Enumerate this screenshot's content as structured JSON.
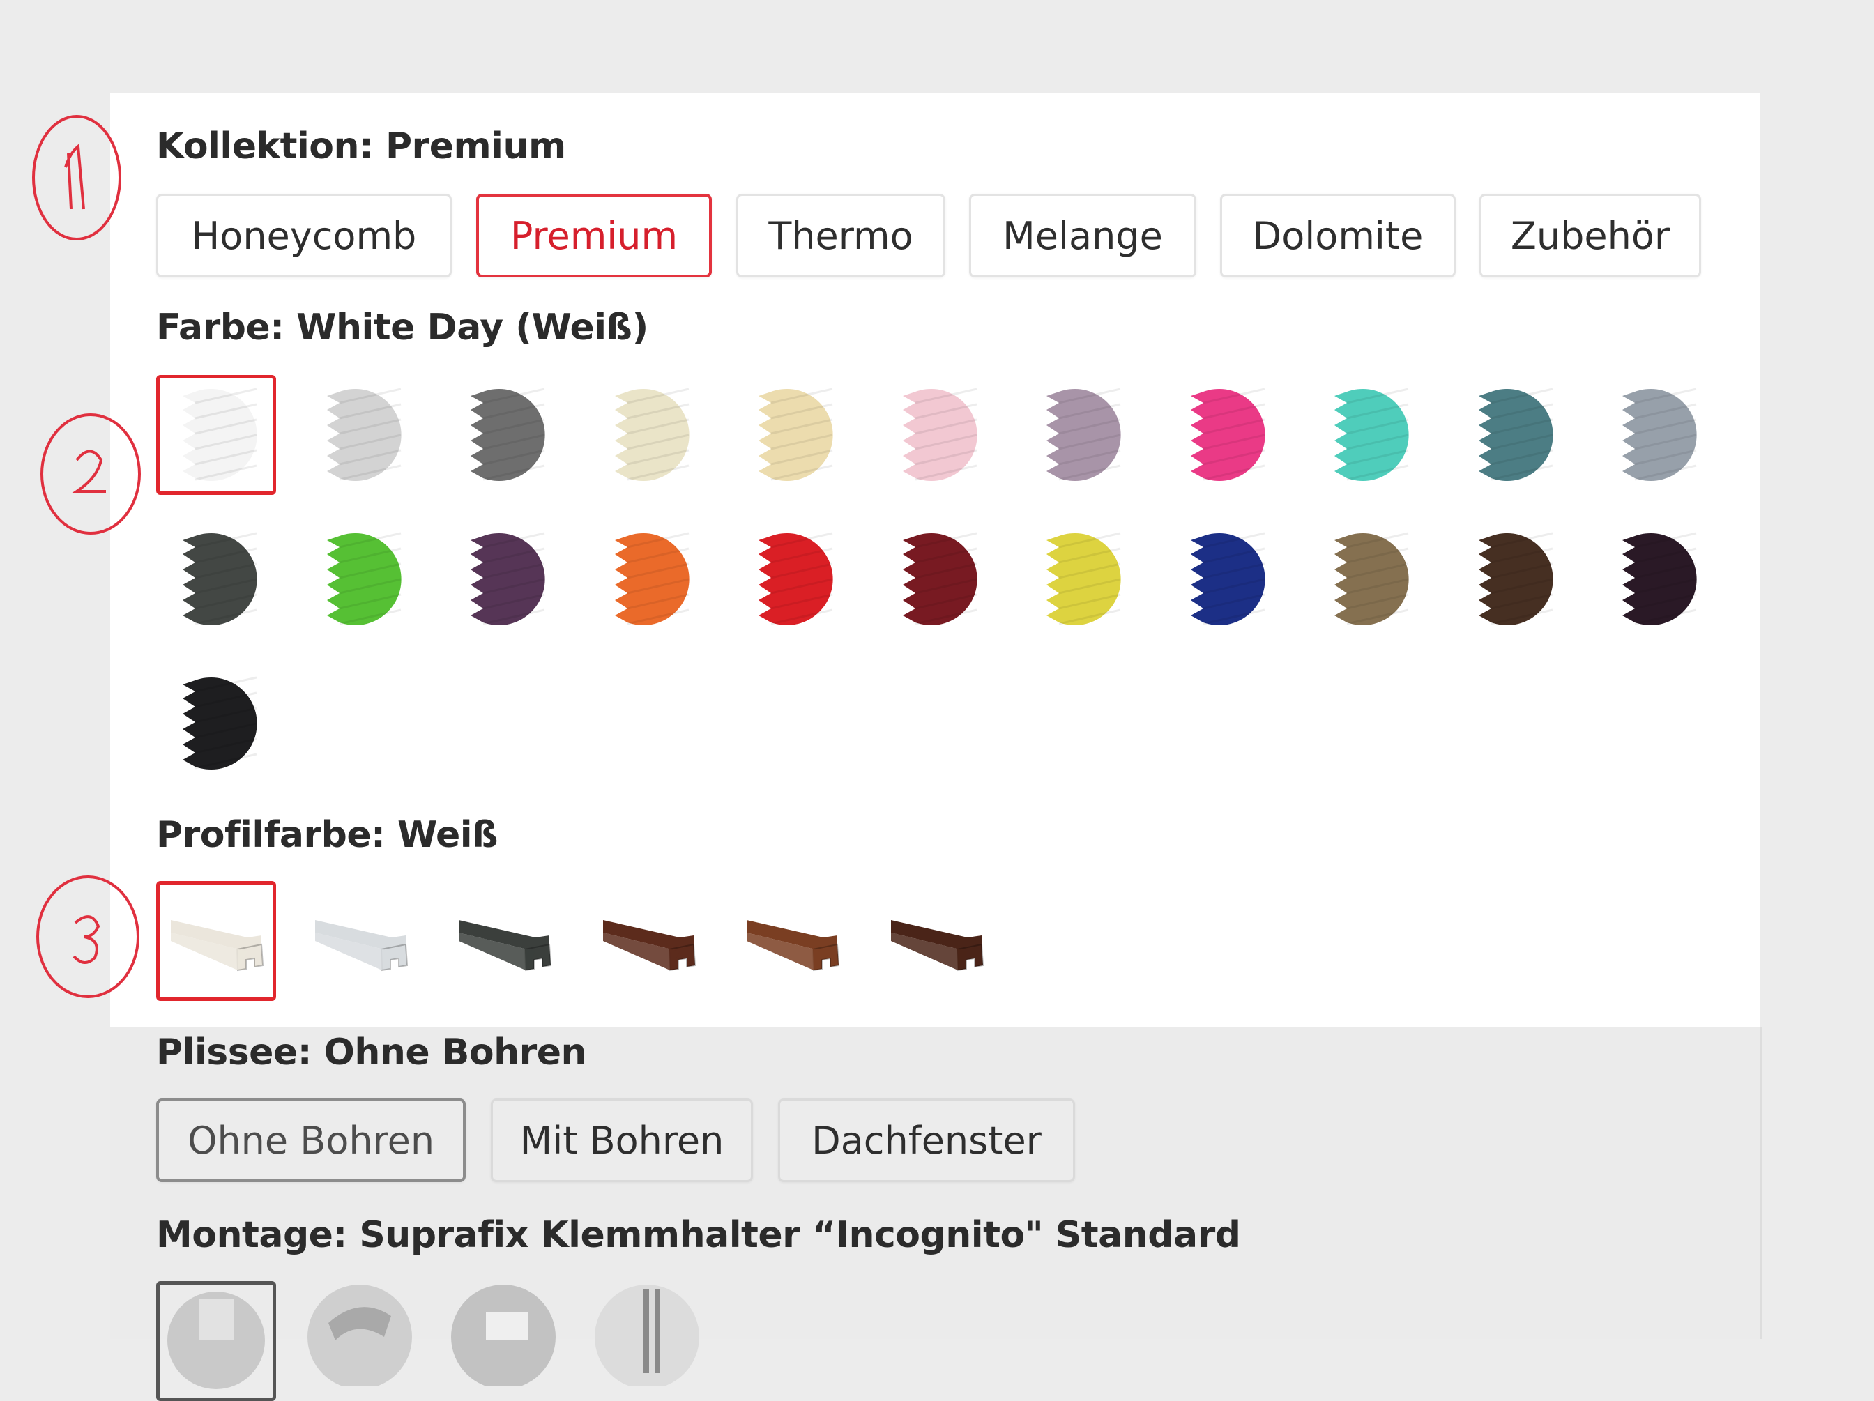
{
  "kollektion": {
    "label": "Kollektion:",
    "value": "Premium",
    "options": [
      "Honeycomb",
      "Premium",
      "Thermo",
      "Melange",
      "Dolomite",
      "Zubehör"
    ],
    "selected_index": 1
  },
  "farbe": {
    "label": "Farbe:",
    "value": "White Day (Weiß)",
    "swatches": [
      "#f4f4f4",
      "#d3d3d3",
      "#6e6e6e",
      "#eae4c8",
      "#ecdcae",
      "#f2c8d2",
      "#a894a8",
      "#ea3a86",
      "#4fcdbb",
      "#4c7d84",
      "#97a0aa",
      "#434744",
      "#56c034",
      "#563556",
      "#ea6a2a",
      "#da1f25",
      "#781a22",
      "#ddd340",
      "#1c2f86",
      "#857050",
      "#462f22",
      "#2a1926",
      "#1e1e20"
    ],
    "selected_index": 0
  },
  "profilfarbe": {
    "label": "Profilfarbe:",
    "value": "Weiß",
    "profiles": [
      "#ebe6dc",
      "#d8dcdf",
      "#3b3f3c",
      "#5c2b1c",
      "#7a3e22",
      "#4a2418"
    ],
    "selected_index": 0
  },
  "plissee": {
    "label": "Plissee:",
    "value": "Ohne Bohren",
    "options": [
      "Ohne Bohren",
      "Mit Bohren",
      "Dachfenster"
    ],
    "selected_index": 0
  },
  "montage": {
    "label": "Montage:",
    "value": "Suprafix Klemmhalter “Incognito\" Standard",
    "options_count": 4,
    "selected_index": 0
  },
  "annotations": [
    "1",
    "2",
    "3"
  ],
  "colors": {
    "accent_red": "#e1262d",
    "marker_red": "#e0303f",
    "text_dark": "#2b2b2b"
  }
}
